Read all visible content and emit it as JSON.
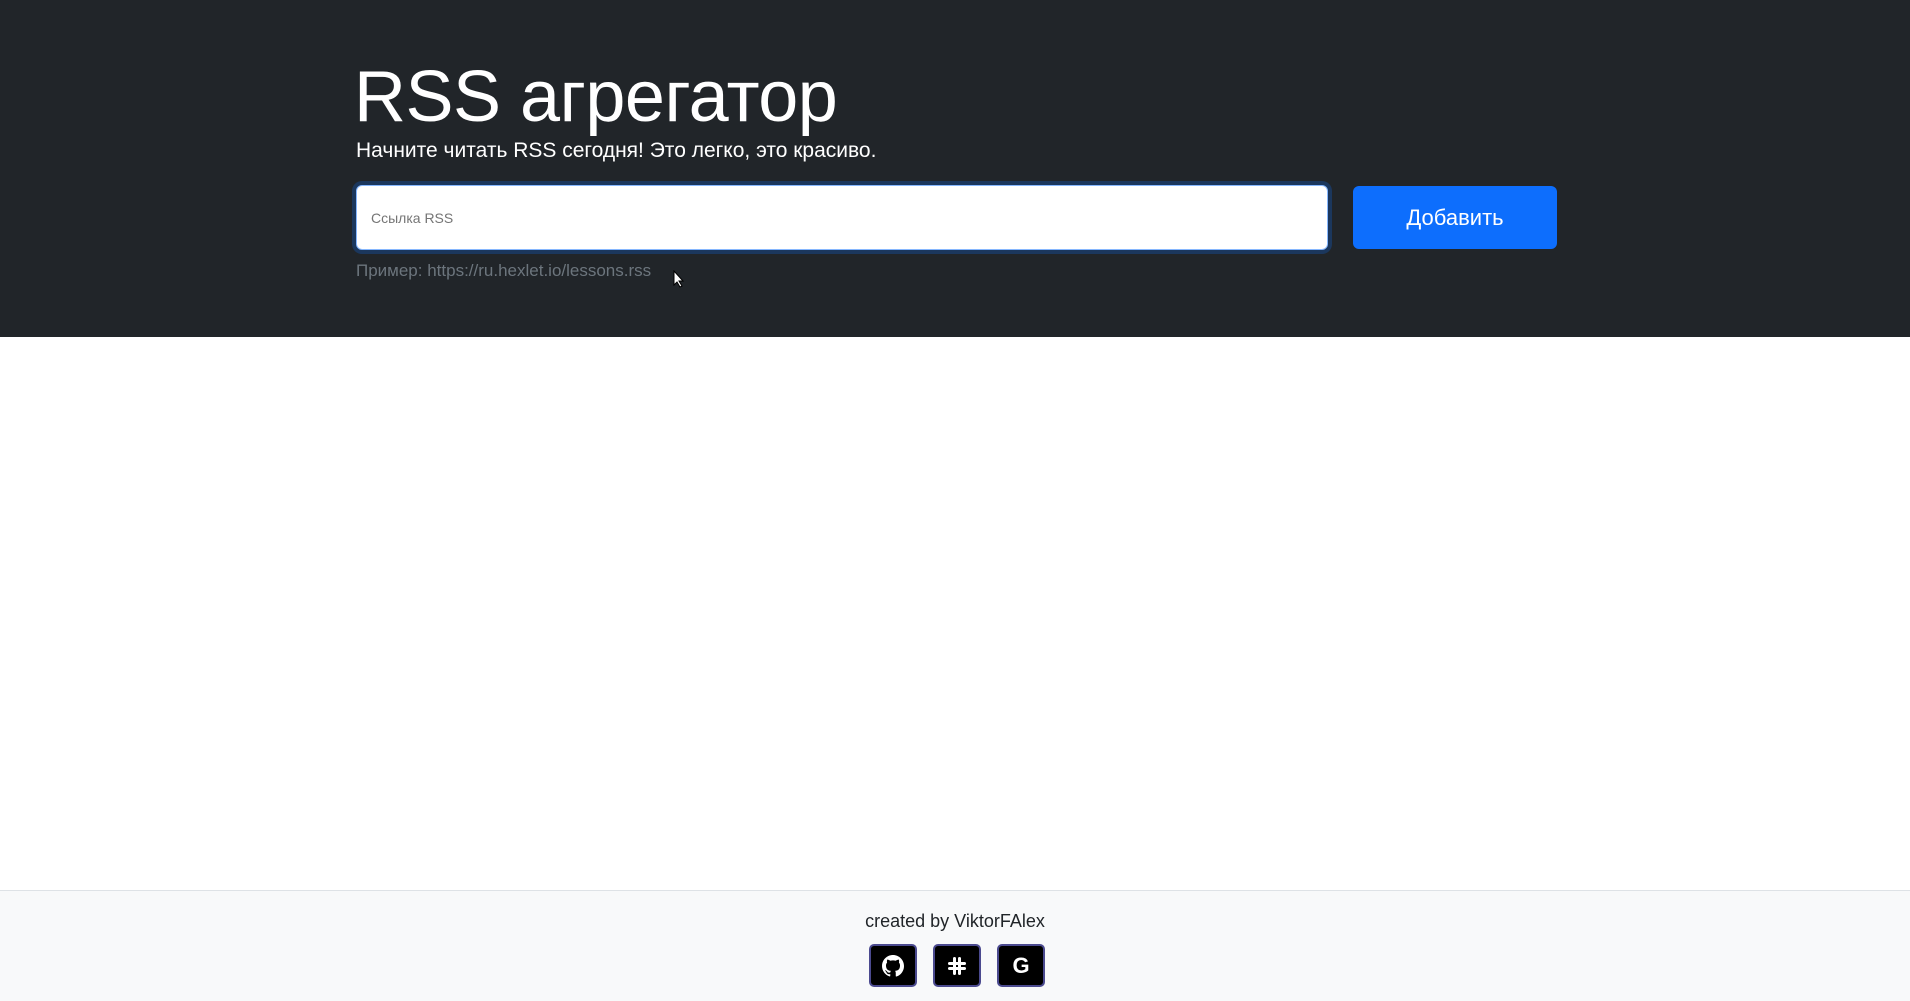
{
  "header": {
    "title": "RSS агрегатор",
    "lead": "Начните читать RSS сегодня! Это легко, это красиво."
  },
  "form": {
    "placeholder": "Ссылка RSS",
    "submit_label": "Добавить",
    "hint": "Пример: https://ru.hexlet.io/lessons.rss"
  },
  "footer": {
    "credit": "created by ViktorFAlex",
    "links": [
      {
        "icon": "github-icon"
      },
      {
        "icon": "slack-icon"
      },
      {
        "icon": "google-icon",
        "glyph": "G"
      }
    ]
  }
}
